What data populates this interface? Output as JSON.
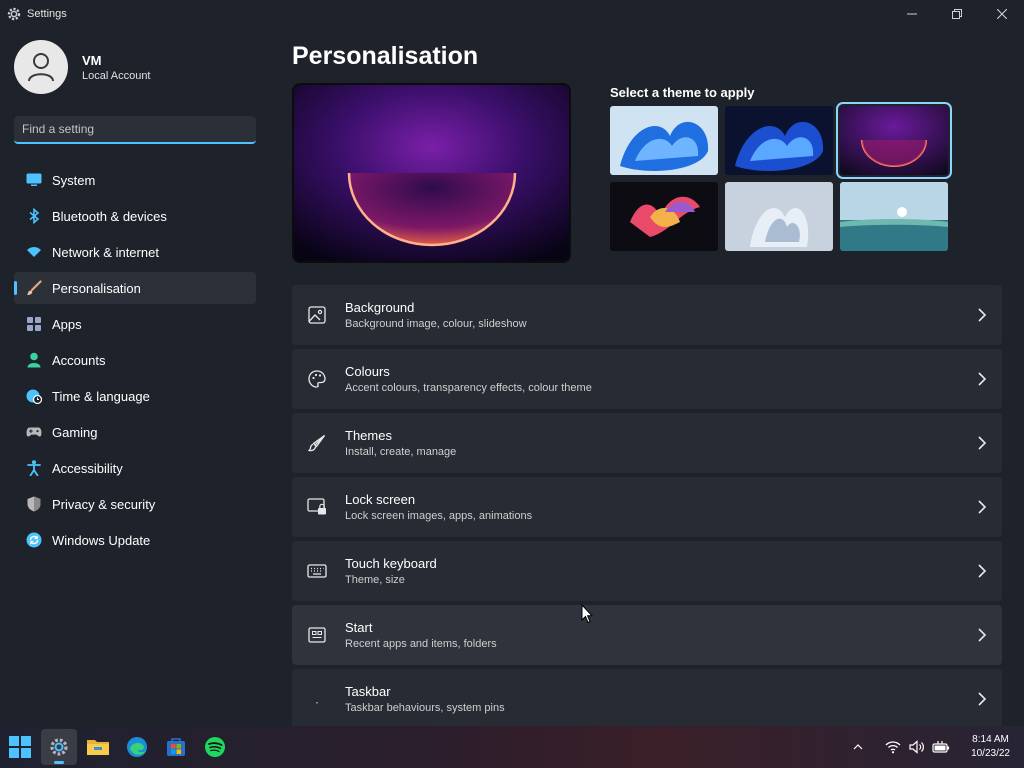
{
  "window": {
    "title": "Settings"
  },
  "profile": {
    "name": "VM",
    "account_type": "Local Account"
  },
  "search": {
    "placeholder": "Find a setting"
  },
  "nav": {
    "items": [
      {
        "label": "System",
        "icon": "monitor-icon",
        "color": "#4cc2ff"
      },
      {
        "label": "Bluetooth & devices",
        "icon": "bluetooth-icon",
        "color": "#4cc2ff"
      },
      {
        "label": "Network & internet",
        "icon": "wifi-icon",
        "color": "#4cc2ff"
      },
      {
        "label": "Personalisation",
        "icon": "brush-icon",
        "color": "#e8a87c",
        "active": true
      },
      {
        "label": "Apps",
        "icon": "apps-icon",
        "color": "#9aa6c8"
      },
      {
        "label": "Accounts",
        "icon": "person-icon",
        "color": "#3ad0a0"
      },
      {
        "label": "Time & language",
        "icon": "globe-clock-icon",
        "color": "#4cc2ff"
      },
      {
        "label": "Gaming",
        "icon": "gamepad-icon",
        "color": "#b8b8b8"
      },
      {
        "label": "Accessibility",
        "icon": "accessibility-icon",
        "color": "#4cc2ff"
      },
      {
        "label": "Privacy & security",
        "icon": "shield-icon",
        "color": "#b8b8b8"
      },
      {
        "label": "Windows Update",
        "icon": "update-icon",
        "color": "#4cc2ff"
      }
    ]
  },
  "main": {
    "title": "Personalisation",
    "themes_label": "Select a theme to apply",
    "themes": [
      {
        "name": "windows-light-bloom"
      },
      {
        "name": "windows-dark-bloom"
      },
      {
        "name": "glow",
        "selected": true
      },
      {
        "name": "captured-motion"
      },
      {
        "name": "sunrise"
      },
      {
        "name": "flow"
      }
    ],
    "settings": [
      {
        "title": "Background",
        "subtitle": "Background image, colour, slideshow",
        "icon": "image-icon"
      },
      {
        "title": "Colours",
        "subtitle": "Accent colours, transparency effects, colour theme",
        "icon": "palette-icon"
      },
      {
        "title": "Themes",
        "subtitle": "Install, create, manage",
        "icon": "brush-icon"
      },
      {
        "title": "Lock screen",
        "subtitle": "Lock screen images, apps, animations",
        "icon": "lock-screen-icon"
      },
      {
        "title": "Touch keyboard",
        "subtitle": "Theme, size",
        "icon": "keyboard-icon"
      },
      {
        "title": "Start",
        "subtitle": "Recent apps and items, folders",
        "icon": "start-icon"
      },
      {
        "title": "Taskbar",
        "subtitle": "Taskbar behaviours, system pins",
        "icon": "taskbar-icon"
      }
    ]
  },
  "taskbar": {
    "apps": [
      {
        "name": "start-button"
      },
      {
        "name": "settings-app",
        "active": true
      },
      {
        "name": "file-explorer-app"
      },
      {
        "name": "edge-app"
      },
      {
        "name": "store-app"
      },
      {
        "name": "spotify-app"
      }
    ],
    "time": "8:14 AM",
    "date": "10/23/22"
  },
  "colors": {
    "accent": "#4cc2ff",
    "background": "#1e222b",
    "card": "#272b34"
  }
}
